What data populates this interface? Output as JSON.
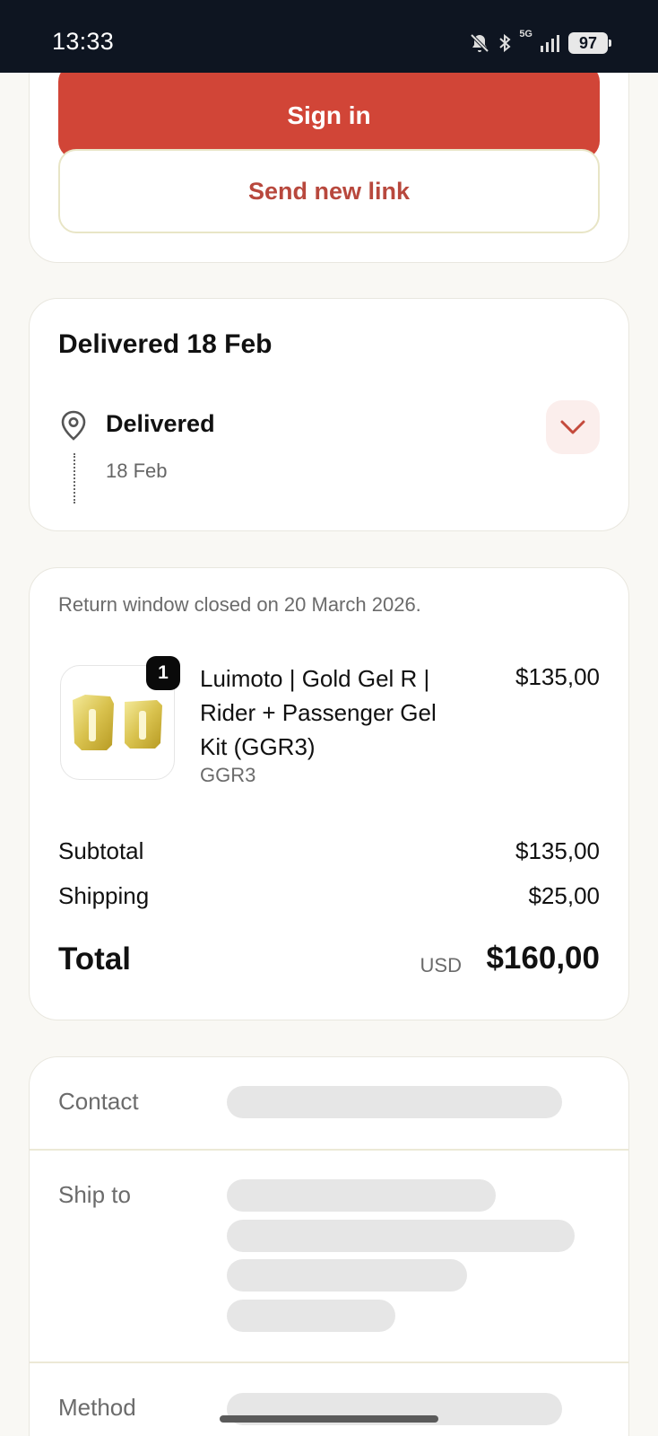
{
  "status_bar": {
    "time": "13:33",
    "network": "5G",
    "battery": "97",
    "icons": [
      "bell-off-icon",
      "bluetooth-icon",
      "signal-icon",
      "battery-icon"
    ]
  },
  "auth": {
    "sign_in_label": "Sign in",
    "send_link_label": "Send new link"
  },
  "delivery": {
    "title": "Delivered 18 Feb",
    "status": "Delivered",
    "date": "18 Feb"
  },
  "order": {
    "return_note": "Return window closed on 20 March 2026.",
    "item": {
      "quantity": "1",
      "name": "Luimoto | Gold Gel R | Rider + Passenger Gel Kit (GGR3)",
      "sku": "GGR3",
      "price": "$135,00"
    },
    "subtotal_label": "Subtotal",
    "subtotal_value": "$135,00",
    "shipping_label": "Shipping",
    "shipping_value": "$25,00",
    "total_label": "Total",
    "currency": "USD",
    "total_value": "$160,00"
  },
  "info": {
    "contact_label": "Contact",
    "ship_to_label": "Ship to",
    "method_label": "Method"
  },
  "colors": {
    "accent": "#d14537",
    "accent_text": "#b8483d",
    "status_bar": "#0e1521",
    "background": "#f9f8f4"
  }
}
